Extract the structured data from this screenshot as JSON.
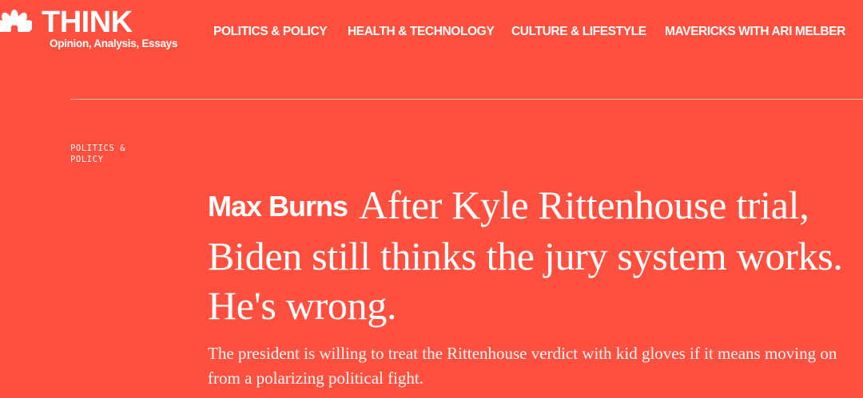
{
  "brand": {
    "name": "THINK",
    "tagline": "Opinion, Analysis, Essays"
  },
  "nav": {
    "items": [
      {
        "label": "POLITICS & POLICY"
      },
      {
        "label": "HEALTH & TECHNOLOGY"
      },
      {
        "label": "CULTURE & LIFESTYLE"
      },
      {
        "label": "MAVERICKS WITH ARI MELBER"
      }
    ]
  },
  "article": {
    "section": "POLITICS & POLICY",
    "author": "Max Burns",
    "headline": "After Kyle Rittenhouse trial, Biden still thinks the jury system works. He's wrong.",
    "dek": "The president is willing to treat the Rittenhouse verdict with kid gloves if it means moving on from a polarizing political fight."
  },
  "colors": {
    "background": "#ff503f",
    "text": "#ffffff"
  },
  "icons": {
    "logo": "nbc-peacock-icon"
  }
}
